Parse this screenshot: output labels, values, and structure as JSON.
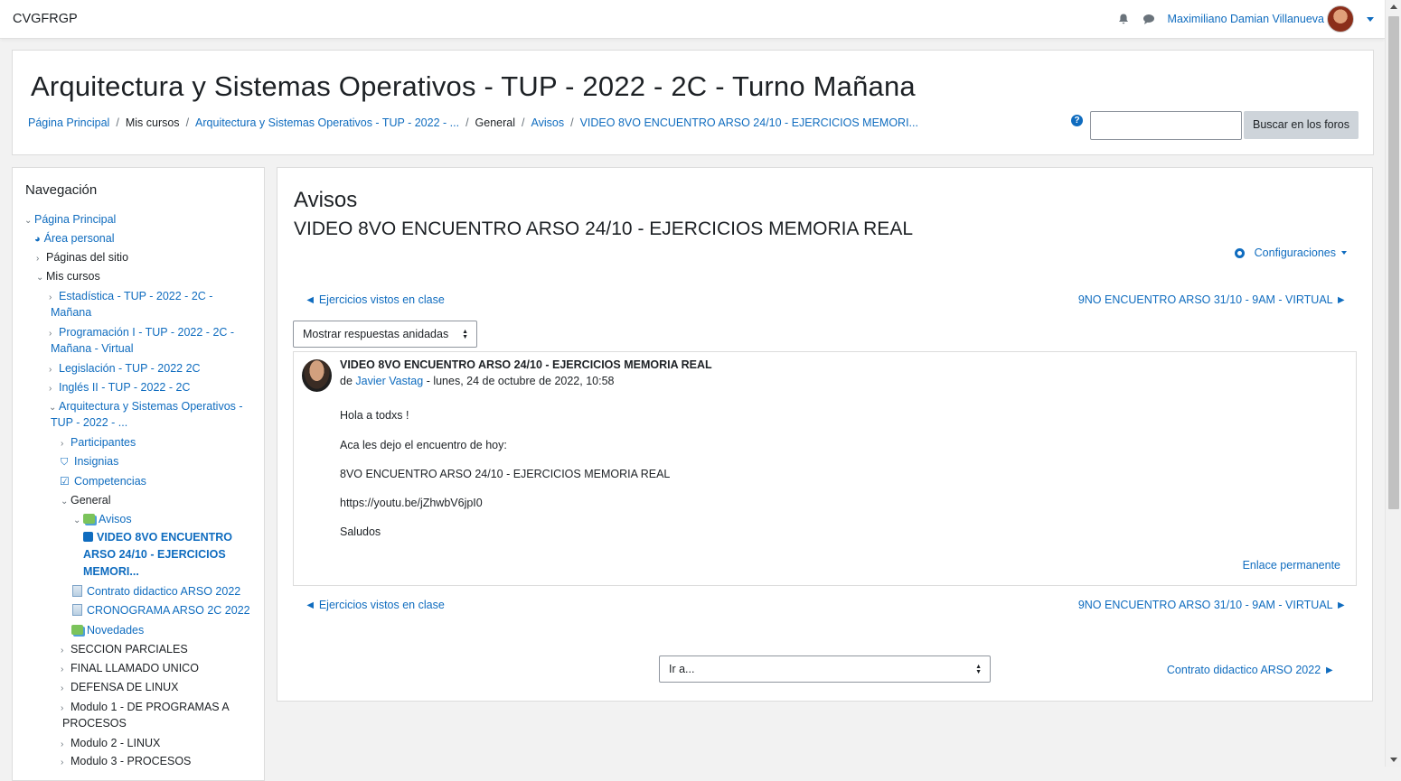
{
  "navbar": {
    "brand": "CVGFRGP",
    "user_name": "Maximiliano Damian Villanueva"
  },
  "header": {
    "title": "Arquitectura y Sistemas Operativos - TUP - 2022 - 2C - Turno Mañana",
    "breadcrumb": [
      "Página Principal",
      "Mis cursos",
      "Arquitectura y Sistemas Operativos - TUP - 2022 - ...",
      "General",
      "Avisos",
      "VIDEO 8VO ENCUENTRO ARSO 24/10 - EJERCICIOS MEMORI..."
    ],
    "help_glyph": "?",
    "search_placeholder": "",
    "search_button": "Buscar en los foros"
  },
  "navigation": {
    "title": "Navegación",
    "items": [
      "Página Principal",
      "Área personal",
      "Páginas del sitio",
      "Mis cursos",
      "Estadística - TUP - 2022 - 2C -",
      "Mañana",
      "Programación I - TUP - 2022 - 2C -",
      "Mañana - Virtual",
      "Legislación - TUP - 2022 2C",
      "Inglés II - TUP - 2022 - 2C",
      "Arquitectura y Sistemas Operativos -",
      "TUP - 2022 - ...",
      "Participantes",
      "Insignias",
      "Competencias",
      "General",
      "Avisos",
      "VIDEO 8VO ENCUENTRO",
      "ARSO 24/10 - EJERCICIOS",
      "MEMORI...",
      "Contrato didactico ARSO 2022",
      "CRONOGRAMA ARSO 2C 2022",
      "Novedades",
      "SECCION PARCIALES",
      "FINAL LLAMADO UNICO",
      "DEFENSA DE LINUX",
      "Modulo 1 - DE PROGRAMAS A",
      "PROCESOS",
      "Modulo 2 - LINUX",
      "Modulo 3 - PROCESOS"
    ]
  },
  "main": {
    "forum_name": "Avisos",
    "discussion_name": "VIDEO 8VO ENCUENTRO ARSO 24/10 - EJERCICIOS MEMORIA REAL",
    "settings_label": "Configuraciones",
    "prev_discussion": "◄ Ejercicios vistos en clase",
    "next_discussion": "9NO ENCUENTRO ARSO 31/10 - 9AM - VIRTUAL ►",
    "display_mode": "Mostrar respuestas anidadas",
    "post": {
      "subject": "VIDEO 8VO ENCUENTRO ARSO 24/10 - EJERCICIOS MEMORIA REAL",
      "by_prefix": "de",
      "author": "Javier Vastag",
      "date": "- lunes, 24 de octubre de 2022, 10:58",
      "body": [
        "Hola a todxs !",
        "Aca les dejo el encuentro de hoy:",
        "8VO ENCUENTRO ARSO 24/10 - EJERCICIOS MEMORIA REAL",
        "https://youtu.be/jZhwbV6jpI0",
        "Saludos"
      ],
      "permalink": "Enlace permanente"
    },
    "jump_to": "Ir a...",
    "next_activity": "Contrato didactico ARSO 2022 ►"
  }
}
